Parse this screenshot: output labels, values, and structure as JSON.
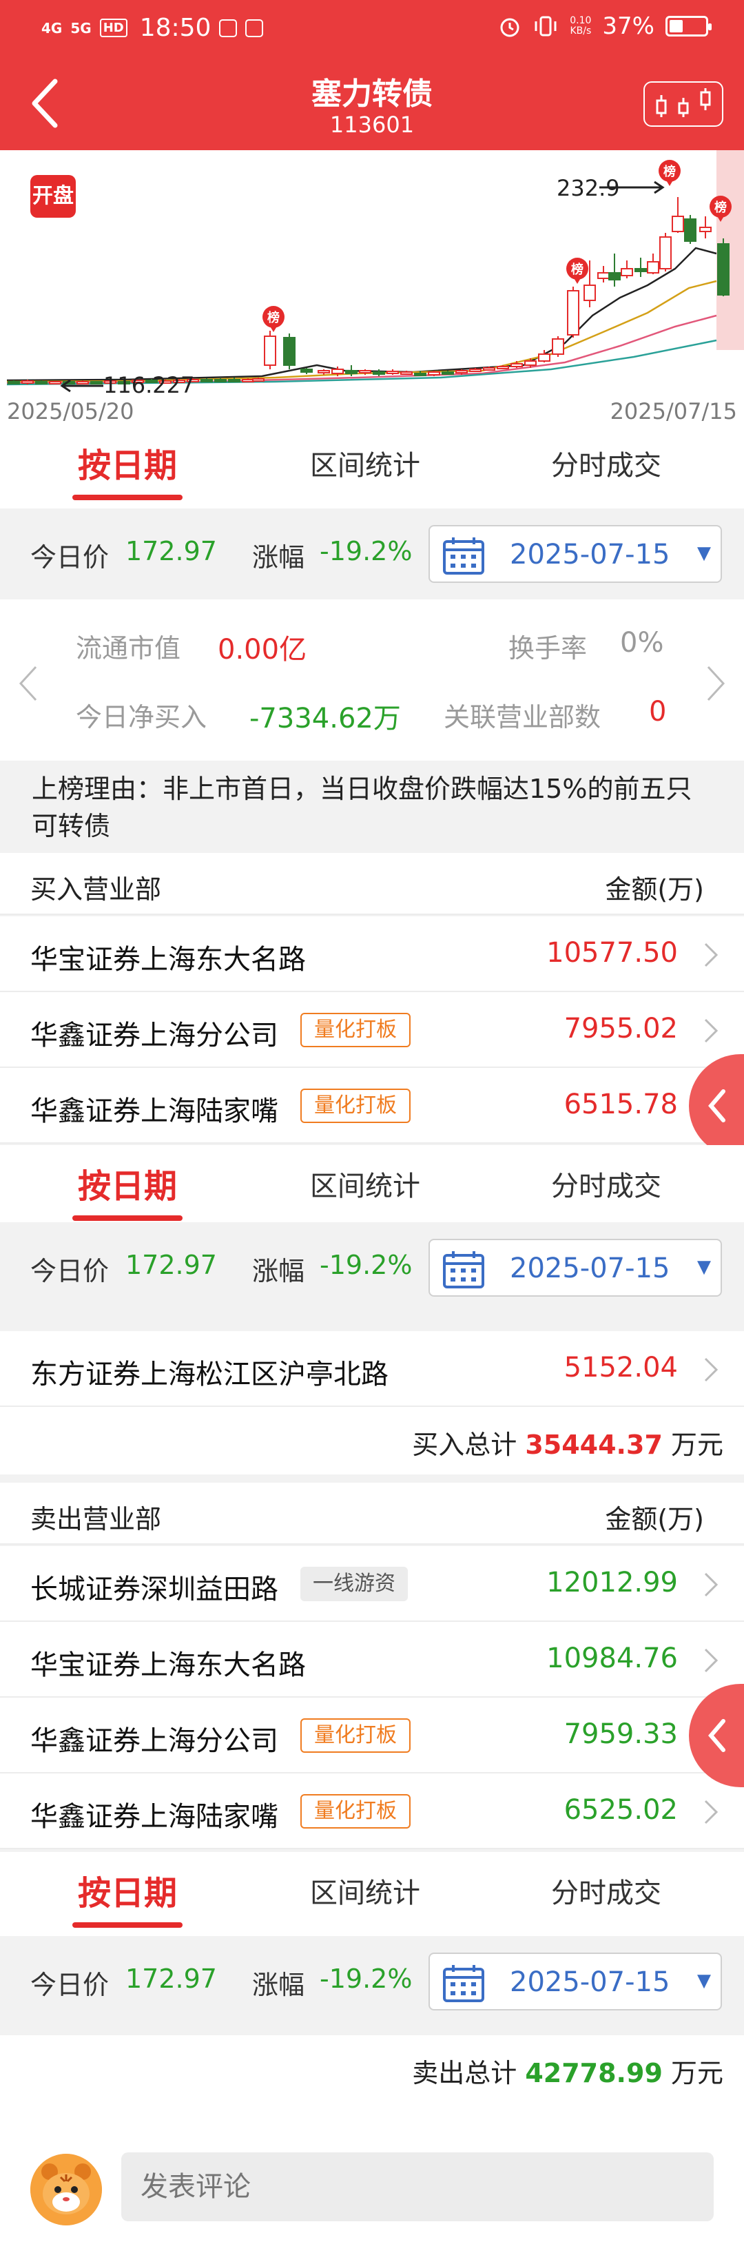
{
  "status_bar": {
    "network1": "4G",
    "network2": "5G",
    "hd": "HD",
    "time": "18:50",
    "speed_value": "0.10",
    "speed_unit": "KB/s",
    "battery_text": "37%",
    "battery_level": 0.37
  },
  "header": {
    "title": "塞力转债",
    "code": "113601"
  },
  "chart": {
    "badge": "开盘",
    "date_start": "2025/05/20",
    "date_end": "2025/07/15",
    "peak_label": "232.9",
    "low_label": "116.227",
    "list_badge": "榜"
  },
  "chart_data": {
    "type": "candlestick",
    "x_start": "2025/05/20",
    "x_end": "2025/07/15",
    "annotations": [
      {
        "label": "232.9",
        "kind": "high"
      },
      {
        "label": "116.227",
        "kind": "low"
      }
    ],
    "colors": {
      "up": "#e52b2b",
      "down": "#2e7d32",
      "ma5": "#222222",
      "ma10": "#d4a017",
      "ma20": "#e2577a",
      "ma30": "#2aa198"
    }
  },
  "tabs": {
    "by_date": "按日期",
    "range_stats": "区间统计",
    "intraday": "分时成交"
  },
  "price_bar": {
    "today_label": "今日价",
    "today_value": "172.97",
    "change_label": "涨幅",
    "change_value": "-19.2%",
    "date": "2025-07-15",
    "caret": "▼"
  },
  "stats": {
    "market_cap_label": "流通市值",
    "market_cap_value": "0.00亿",
    "turnover_label": "换手率",
    "turnover_value": "0%",
    "net_buy_label": "今日净买入",
    "net_buy_value": "-7334.62万",
    "dept_count_label": "关联营业部数",
    "dept_count_value": "0"
  },
  "reason": {
    "text": "上榜理由：非上市首日，当日收盘价跌幅达15%的前五只可转债"
  },
  "buy": {
    "header_name": "买入营业部",
    "header_amount": "金额(万)",
    "rows": [
      {
        "name": "华宝证券上海东大名路",
        "tag": "",
        "amount": "10577.50"
      },
      {
        "name": "华鑫证券上海分公司",
        "tag": "量化打板",
        "amount": "7955.02"
      },
      {
        "name": "华鑫证券上海陆家嘴",
        "tag": "量化打板",
        "amount": "6515.78"
      },
      {
        "name": "东方证券上海松江区沪亭北路",
        "tag": "",
        "amount": "5152.04"
      }
    ],
    "total_label": "买入总计",
    "total_value": "35444.37",
    "total_unit": "万元"
  },
  "sell": {
    "header_name": "卖出营业部",
    "header_amount": "金额(万)",
    "rows": [
      {
        "name": "长城证券深圳益田路",
        "tag": "一线游资",
        "amount": "12012.99"
      },
      {
        "name": "华宝证券上海东大名路",
        "tag": "",
        "amount": "10984.76"
      },
      {
        "name": "华鑫证券上海分公司",
        "tag": "量化打板",
        "amount": "7959.33"
      },
      {
        "name": "华鑫证券上海陆家嘴",
        "tag": "量化打板",
        "amount": "6525.02"
      }
    ],
    "total_label": "卖出总计",
    "total_value": "42778.99",
    "total_unit": "万元"
  },
  "comment": {
    "placeholder": "发表评论"
  }
}
